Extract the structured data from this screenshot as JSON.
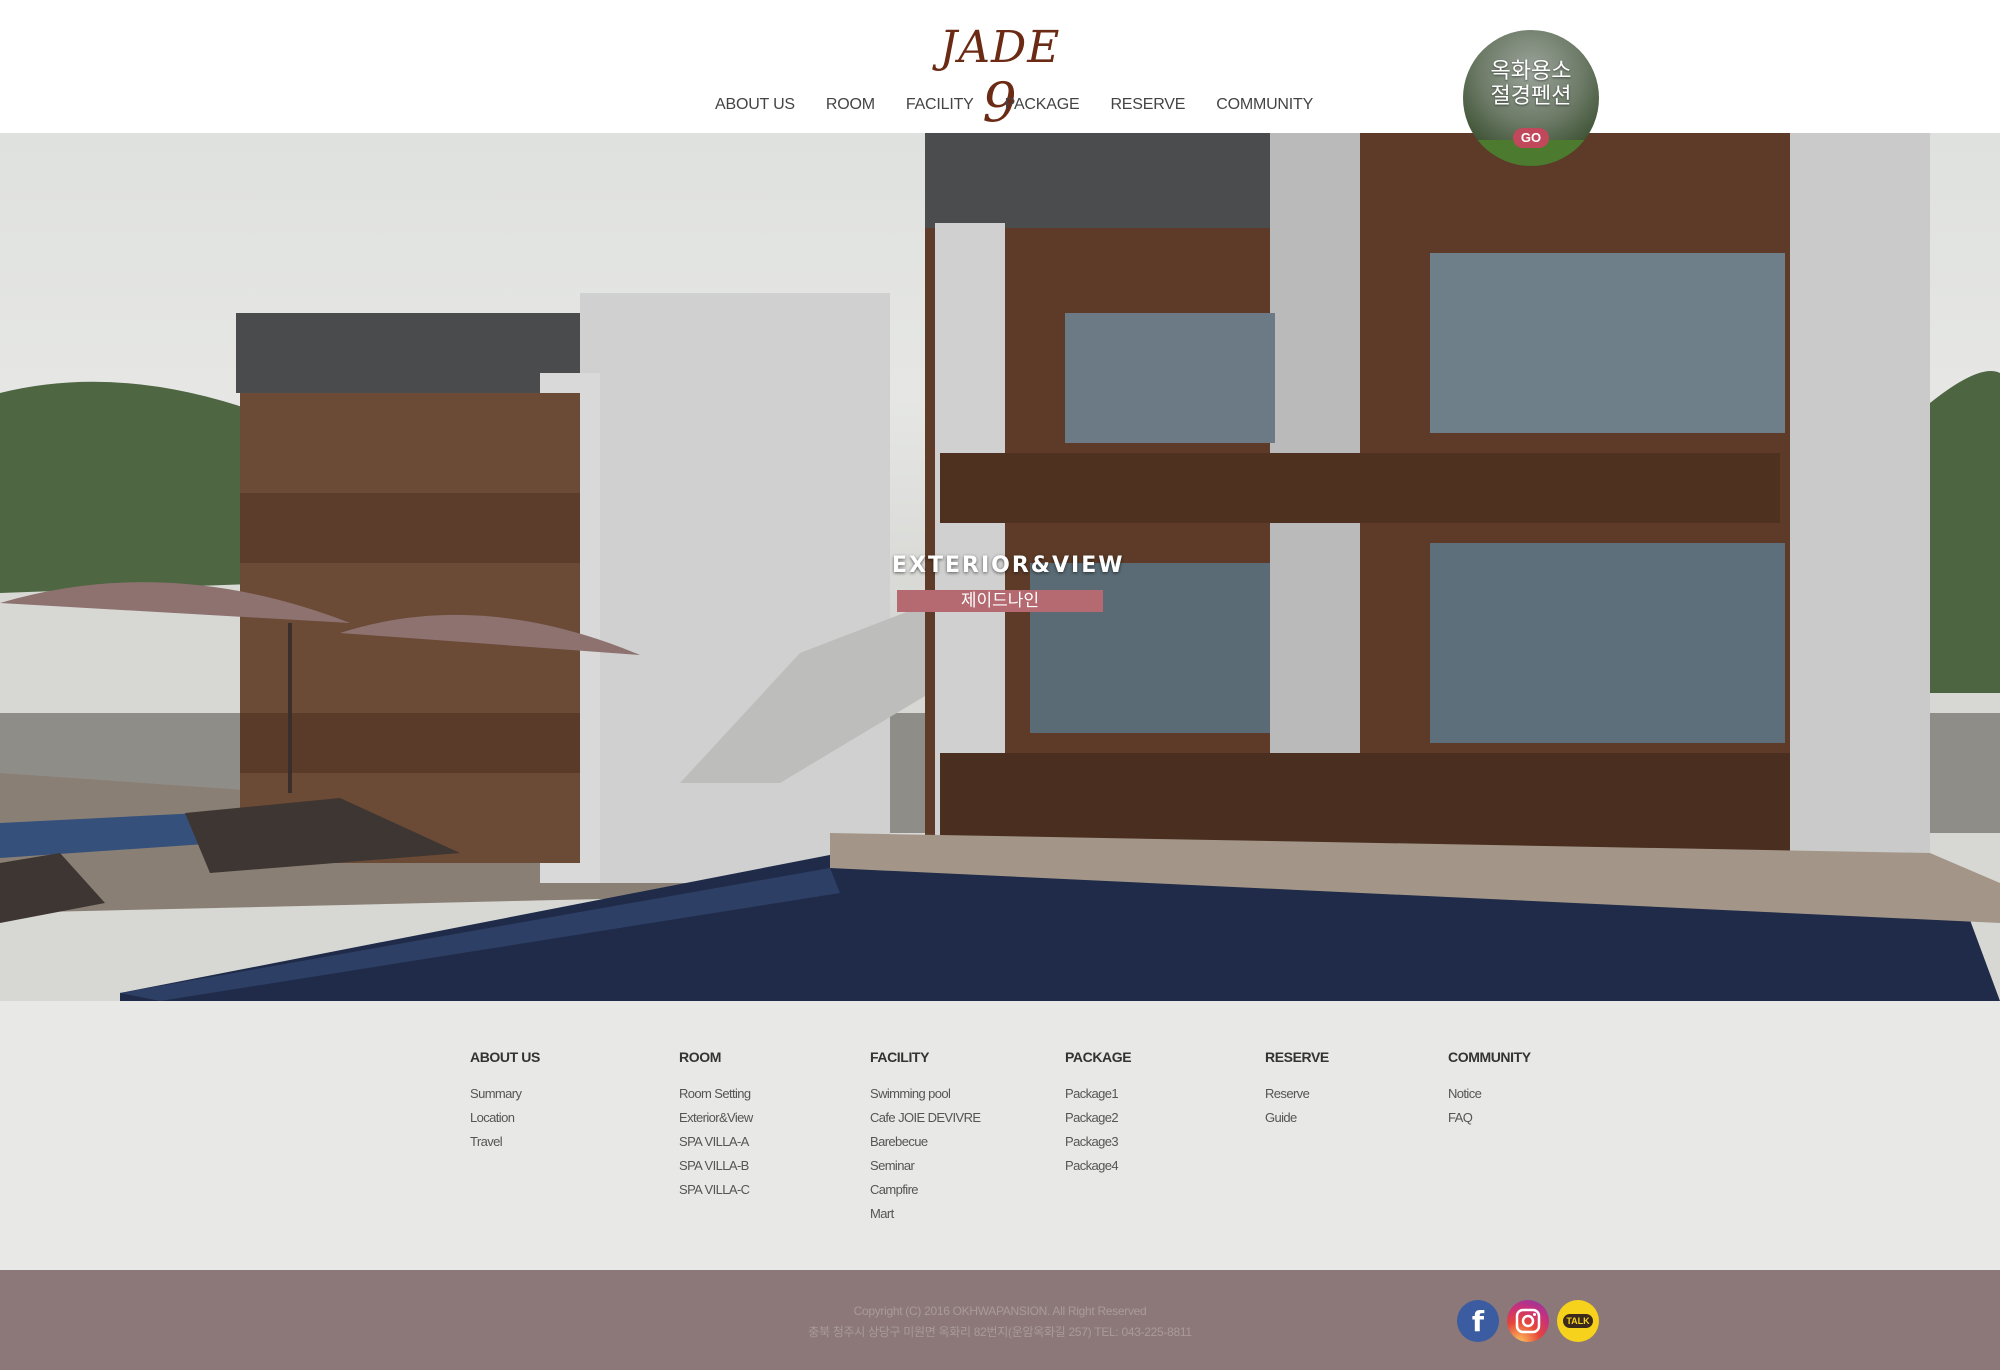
{
  "header": {
    "logo": "JADE",
    "logo_num": "9",
    "nav": [
      "ABOUT US",
      "ROOM",
      "FACILITY",
      "PACKAGE",
      "RESERVE",
      "COMMUNITY"
    ],
    "badge": {
      "line1": "옥화용소",
      "line2": "절경펜션",
      "go": "GO"
    }
  },
  "hero": {
    "title": "EXTERIOR&VIEW",
    "subtitle": "제이드나인"
  },
  "footer": {
    "columns": [
      {
        "title": "ABOUT US",
        "links": [
          "Summary",
          "Location",
          "Travel"
        ]
      },
      {
        "title": "ROOM",
        "links": [
          "Room Setting",
          "Exterior&View",
          "SPA VILLA-A",
          "SPA VILLA-B",
          "SPA VILLA-C"
        ]
      },
      {
        "title": "FACILITY",
        "links": [
          "Swimming pool",
          "Cafe JOIE DEVIVRE",
          "Barebecue",
          "Seminar",
          "Campfire",
          "Mart"
        ]
      },
      {
        "title": "PACKAGE",
        "links": [
          "Package1",
          "Package2",
          "Package3",
          "Package4"
        ]
      },
      {
        "title": "RESERVE",
        "links": [
          "Reserve",
          "Guide"
        ]
      },
      {
        "title": "COMMUNITY",
        "links": [
          "Notice",
          "FAQ"
        ]
      }
    ],
    "copyright": "Copyright (C) 2016 OKHWAPANSION. All Right Reserved",
    "address": "충북 청주시 상당구 미원면 옥화리 82번지(운암옥화길 257) TEL: 043-225-8811",
    "social": [
      {
        "icon": "facebook-icon",
        "glyph": "f"
      },
      {
        "icon": "instagram-icon"
      },
      {
        "icon": "kakaotalk-icon",
        "label": "TALK"
      }
    ]
  }
}
